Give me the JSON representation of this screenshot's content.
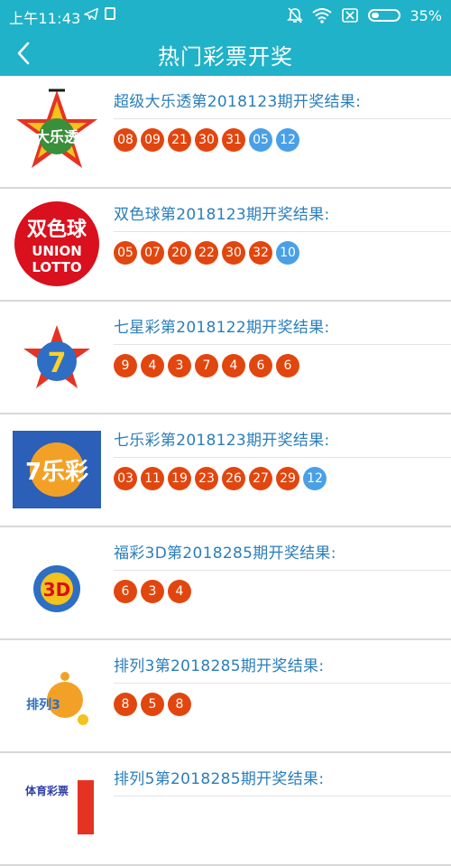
{
  "status_bar": {
    "time": "上午11:43",
    "battery": "35%",
    "battery_level": 0.35
  },
  "header": {
    "title": "热门彩票开奖"
  },
  "colors": {
    "accent": "#1fb2c8",
    "red_ball": "#e2460f",
    "blue_ball": "#4aa0e6",
    "title_text": "#2a7ebb"
  },
  "lotteries": [
    {
      "logo": "daletou-logo",
      "logo_text": "大乐透",
      "title": "超级大乐透第2018123期开奖结果:",
      "red": [
        "08",
        "09",
        "21",
        "30",
        "31"
      ],
      "blue": [
        "05",
        "12"
      ]
    },
    {
      "logo": "shuangseqiu-logo",
      "logo_text": "双色球",
      "logo_text2": "UNION",
      "logo_text3": "LOTTO",
      "title": "双色球第2018123期开奖结果:",
      "red": [
        "05",
        "07",
        "20",
        "22",
        "30",
        "32"
      ],
      "blue": [
        "10"
      ]
    },
    {
      "logo": "qixingcai-logo",
      "logo_text": "7",
      "title": "七星彩第2018122期开奖结果:",
      "red": [
        "9",
        "4",
        "3",
        "7",
        "4",
        "6",
        "6"
      ],
      "blue": []
    },
    {
      "logo": "qilecai-logo",
      "logo_text": "7乐彩",
      "title": "七乐彩第2018123期开奖结果:",
      "red": [
        "03",
        "11",
        "19",
        "23",
        "26",
        "27",
        "29"
      ],
      "blue": [
        "12"
      ]
    },
    {
      "logo": "fucai3d-logo",
      "logo_text": "3D",
      "title": "福彩3D第2018285期开奖结果:",
      "red": [
        "6",
        "3",
        "4"
      ],
      "blue": []
    },
    {
      "logo": "pailie3-logo",
      "logo_text": "排列3",
      "title": "排列3第2018285期开奖结果:",
      "red": [
        "8",
        "5",
        "8"
      ],
      "blue": []
    },
    {
      "logo": "pailie5-logo",
      "logo_text": "体育彩票",
      "title": "排列5第2018285期开奖结果:",
      "red": [],
      "blue": []
    }
  ]
}
